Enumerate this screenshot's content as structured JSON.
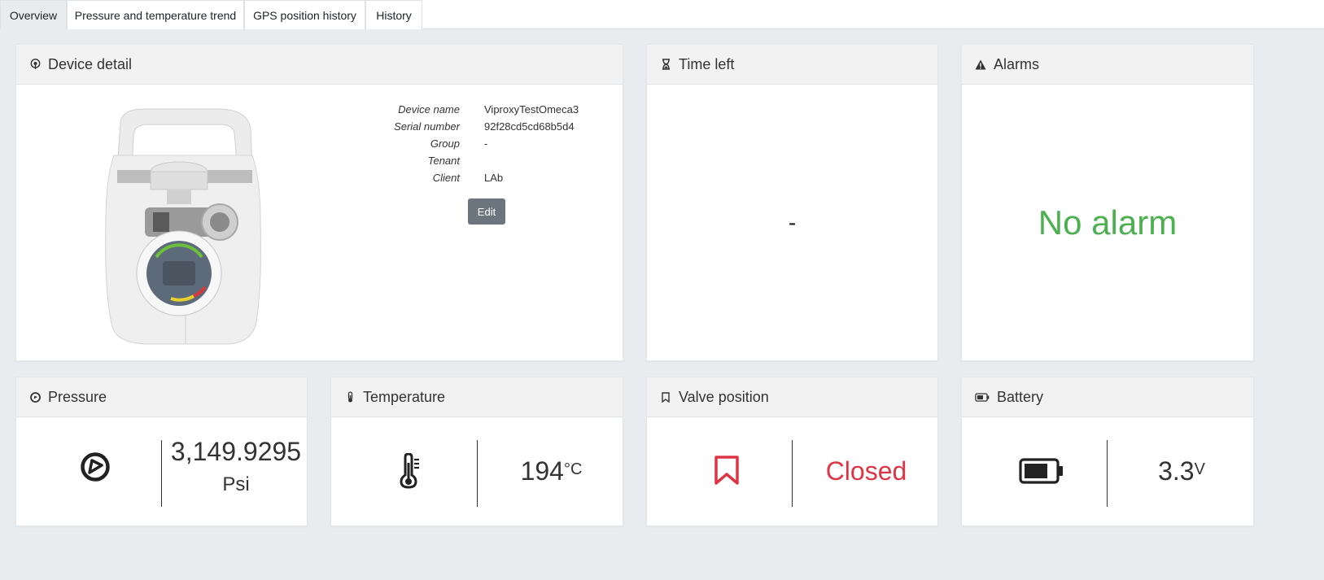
{
  "tabs": [
    {
      "label": "Overview",
      "active": true
    },
    {
      "label": "Pressure and temperature trend",
      "active": false
    },
    {
      "label": "GPS position history",
      "active": false
    },
    {
      "label": "History",
      "active": false
    }
  ],
  "device_detail": {
    "title": "Device detail",
    "icon": "device-detail-icon",
    "fields": [
      {
        "label": "Device name",
        "value": "ViproxyTestOmeca3"
      },
      {
        "label": "Serial number",
        "value": "92f28cd5cd68b5d4"
      },
      {
        "label": "Group",
        "value": "-"
      },
      {
        "label": "Tenant",
        "value": ""
      },
      {
        "label": "Client",
        "value": "LAb"
      }
    ],
    "edit_label": "Edit"
  },
  "time_left": {
    "title": "Time left",
    "icon": "hourglass-icon",
    "value": "-"
  },
  "alarms": {
    "title": "Alarms",
    "icon": "warning-icon",
    "value": "No alarm",
    "color": "#4caf50"
  },
  "pressure": {
    "title": "Pressure",
    "icon": "gauge-icon",
    "value": "3,149.9295",
    "unit": "Psi"
  },
  "temperature": {
    "title": "Temperature",
    "icon": "thermometer-icon",
    "value": "194",
    "unit": "°C"
  },
  "valve": {
    "title": "Valve position",
    "icon": "bookmark-icon",
    "value": "Closed",
    "color": "#dc3545"
  },
  "battery": {
    "title": "Battery",
    "icon": "battery-icon",
    "value": "3.3",
    "unit": "V"
  }
}
